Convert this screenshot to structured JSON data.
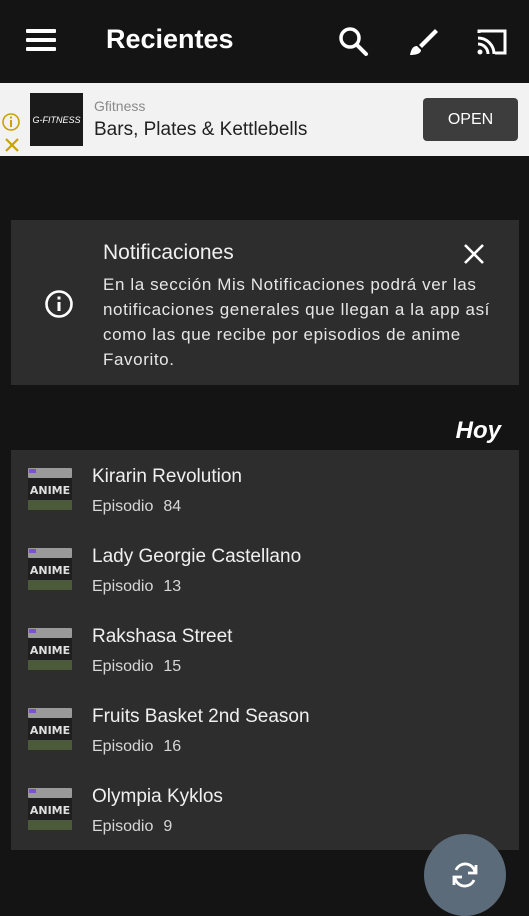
{
  "appbar": {
    "title": "Recientes",
    "icons": [
      "menu-icon",
      "search-icon",
      "brush-icon",
      "cast-icon"
    ]
  },
  "ad": {
    "logo_text": "G-FITNESS",
    "brand": "Gfitness",
    "headline": "Bars, Plates & Kettlebells",
    "cta": "OPEN"
  },
  "notice": {
    "title": "Notificaciones",
    "body": "En la sección Mis Notificaciones podrá ver las notificaciones generales que llegan a la app así como las que recibe por episodios de anime Favorito."
  },
  "section": {
    "label": "Hoy"
  },
  "episodes": [
    {
      "title": "Kirarin Revolution",
      "ep_label": "Episodio",
      "ep_num": "84"
    },
    {
      "title": "Lady Georgie Castellano",
      "ep_label": "Episodio",
      "ep_num": "13"
    },
    {
      "title": "Rakshasa Street",
      "ep_label": "Episodio",
      "ep_num": "15"
    },
    {
      "title": "Fruits Basket 2nd Season",
      "ep_label": "Episodio",
      "ep_num": "16"
    },
    {
      "title": "Olympia Kyklos",
      "ep_label": "Episodio",
      "ep_num": "9"
    }
  ],
  "thumb_text": "ANIME",
  "colors": {
    "background": "#141414",
    "card": "#2d2d2d",
    "fab": "#5c6b7a",
    "ad_bg": "#f2f2f2"
  }
}
